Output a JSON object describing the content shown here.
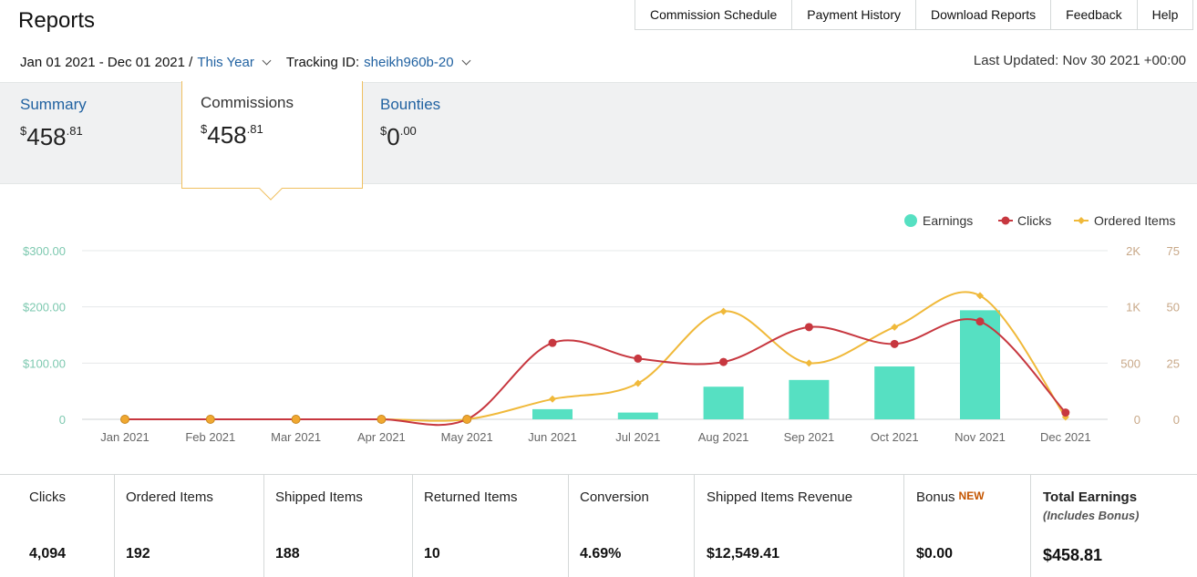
{
  "header": {
    "title": "Reports",
    "nav": [
      "Commission Schedule",
      "Payment History",
      "Download Reports",
      "Feedback",
      "Help"
    ]
  },
  "filters": {
    "date_range": "Jan 01 2021 - Dec 01 2021 /",
    "period_label": "This Year",
    "tracking_label": "Tracking ID:",
    "tracking_id": "sheikh960b-20",
    "last_updated": "Last Updated: Nov 30 2021 +00:00"
  },
  "tabs": {
    "summary": {
      "label": "Summary",
      "currency": "$",
      "dollars": "458",
      "cents": ".81"
    },
    "commissions": {
      "label": "Commissions",
      "currency": "$",
      "dollars": "458",
      "cents": ".81"
    },
    "bounties": {
      "label": "Bounties",
      "currency": "$",
      "dollars": "0",
      "cents": ".00"
    }
  },
  "colors": {
    "earnings": "#56e0c2",
    "clicks": "#c7373f",
    "ordered": "#f0b93a",
    "left_axis": "#7ec9b0",
    "right_axis": "#c8a888"
  },
  "chart_data": {
    "type": "bar",
    "categories": [
      "Jan 2021",
      "Feb 2021",
      "Mar 2021",
      "Apr 2021",
      "May 2021",
      "Jun 2021",
      "Jul 2021",
      "Aug 2021",
      "Sep 2021",
      "Oct 2021",
      "Nov 2021",
      "Dec 2021"
    ],
    "series": [
      {
        "name": "Earnings",
        "type": "bar",
        "axis": "left",
        "values": [
          0,
          0,
          0,
          0,
          0,
          18,
          12,
          58,
          70,
          94,
          194,
          0
        ]
      },
      {
        "name": "Clicks",
        "type": "line",
        "axis": "right1",
        "values": [
          0,
          0,
          0,
          0,
          0,
          680,
          540,
          510,
          820,
          670,
          870,
          60
        ]
      },
      {
        "name": "Ordered Items",
        "type": "line",
        "axis": "right2",
        "values": [
          0,
          0,
          0,
          0,
          0,
          9,
          16,
          48,
          25,
          41,
          55,
          1
        ]
      }
    ],
    "left_axis": {
      "ticks": [
        "0",
        "$100.00",
        "$200.00",
        "$300.00"
      ],
      "max": 300
    },
    "right_axis_1": {
      "ticks": [
        "0",
        "500",
        "1K",
        "2K"
      ],
      "max": 1500
    },
    "right_axis_2": {
      "ticks": [
        "0",
        "25",
        "50",
        "75"
      ],
      "max": 75
    },
    "legend_position": "top-right",
    "grid": true
  },
  "stats": [
    {
      "label": "Clicks",
      "value": "4,094"
    },
    {
      "label": "Ordered Items",
      "value": "192"
    },
    {
      "label": "Shipped Items",
      "value": "188"
    },
    {
      "label": "Returned Items",
      "value": "10"
    },
    {
      "label": "Conversion",
      "value": "4.69%"
    },
    {
      "label": "Shipped Items Revenue",
      "value": "$12,549.41"
    },
    {
      "label": "Bonus",
      "badge": "NEW",
      "value": "$0.00"
    },
    {
      "label": "Total Earnings",
      "sub": "(Includes Bonus)",
      "value": "$458.81"
    }
  ]
}
